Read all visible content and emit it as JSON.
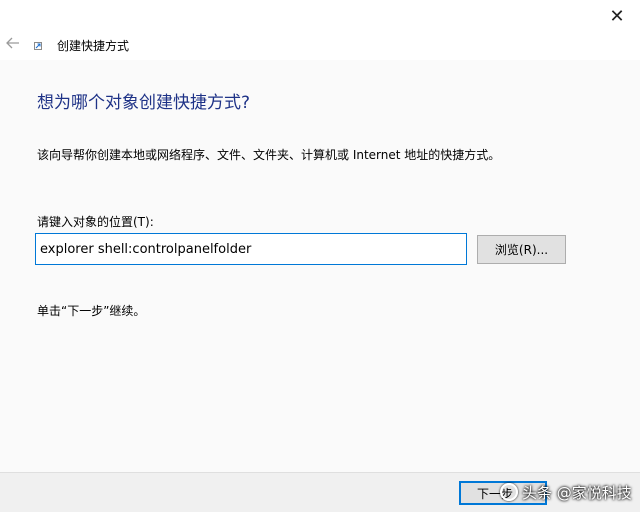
{
  "window": {
    "title": "创建快捷方式",
    "close_glyph": "✕",
    "back_icon": "back-arrow-icon",
    "wizard_icon": "shortcut-icon"
  },
  "page": {
    "heading": "想为哪个对象创建快捷方式?",
    "description": "该向导帮你创建本地或网络程序、文件、文件夹、计算机或 Internet 地址的快捷方式。",
    "location_label": "请键入对象的位置(T):",
    "location_value": "explorer shell:controlpanelfolder",
    "browse_label": "浏览(R)...",
    "hint": "单击“下一步”继续。"
  },
  "footer": {
    "next_label": "下一步"
  },
  "watermark": {
    "text": "头条 @家悦科技"
  },
  "colors": {
    "heading": "#1e3287",
    "accent": "#0078d7"
  }
}
